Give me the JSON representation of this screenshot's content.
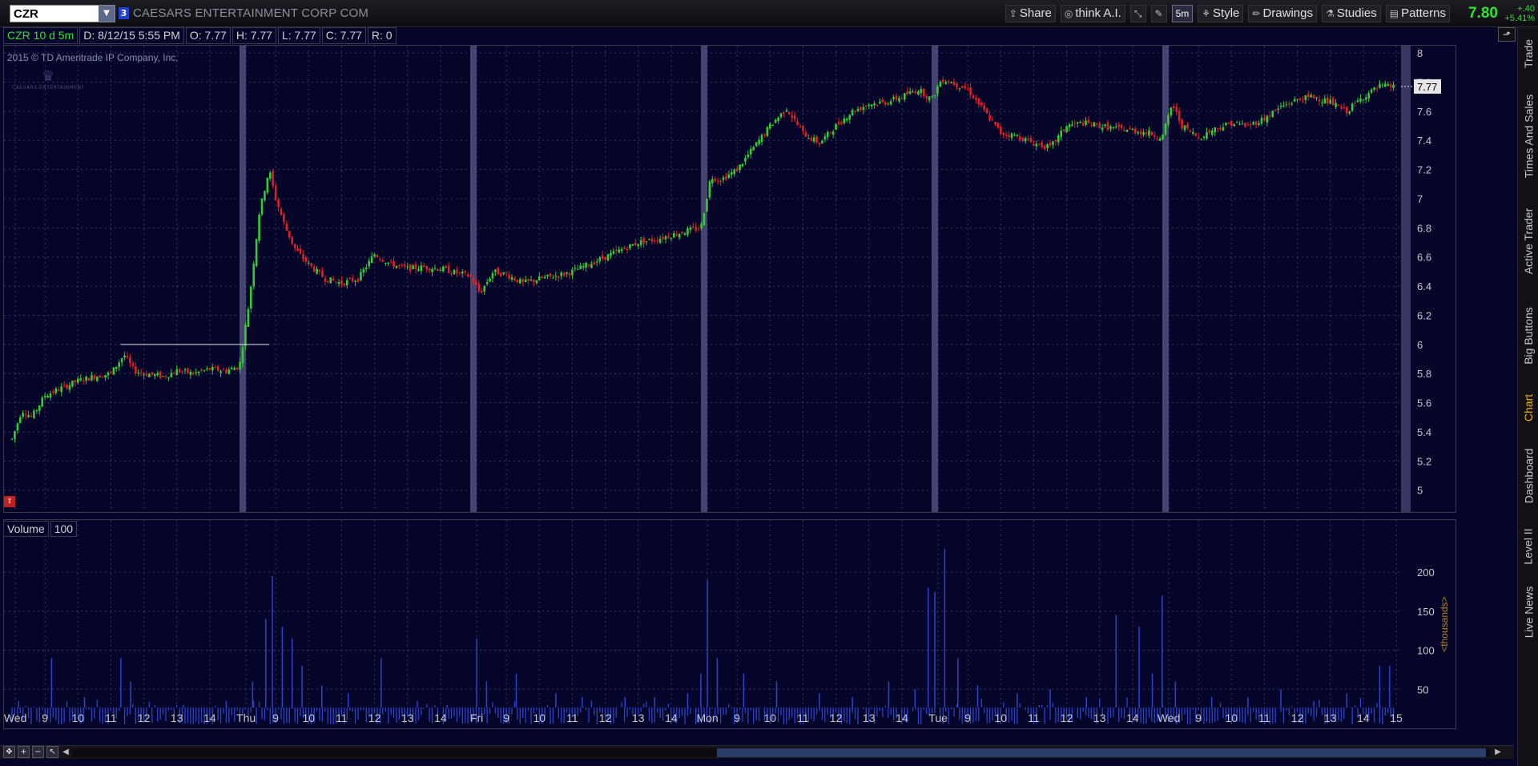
{
  "header": {
    "symbol": "CZR",
    "link_number": "3",
    "company_name": "CAESARS ENTERTAINMENT CORP COM",
    "tools": [
      {
        "label": "Share",
        "icon": "share-icon"
      },
      {
        "label": "think A.I.",
        "icon": "ai-icon"
      },
      {
        "label": "",
        "icon": "drawing-tools-icon"
      },
      {
        "label": "",
        "icon": "wrench-icon"
      },
      {
        "label": "5m",
        "icon": "aggregation-icon"
      },
      {
        "label": "Style",
        "icon": "style-icon"
      },
      {
        "label": "Drawings",
        "icon": "pencil-icon"
      },
      {
        "label": "Studies",
        "icon": "studies-icon"
      },
      {
        "label": "Patterns",
        "icon": "patterns-icon"
      }
    ],
    "last_price": "7.80",
    "change": "+.40",
    "change_pct": "+5.41%",
    "up_color": "#33e033"
  },
  "side_tabs": [
    {
      "label": "Trade",
      "active": false
    },
    {
      "label": "Times And Sales",
      "active": false
    },
    {
      "label": "Active Trader",
      "active": false
    },
    {
      "label": "Big Buttons",
      "active": false
    },
    {
      "label": "Chart",
      "active": true
    },
    {
      "label": "Dashboard",
      "active": false
    },
    {
      "label": "Level II",
      "active": false
    },
    {
      "label": "Live News",
      "active": false
    }
  ],
  "info_bar": {
    "symbol_period": "CZR 10 d 5m",
    "date": "D: 8/12/15 5:55 PM",
    "open": "O: 7.77",
    "high": "H: 7.77",
    "low": "L: 7.77",
    "close": "C: 7.77",
    "range": "R: 0"
  },
  "copyright": "2015 © TD Ameritrade IP Company, Inc.",
  "logo_text": "CAESARS ENTERTAINMENT",
  "volume_panel": {
    "label": "Volume",
    "value": "100",
    "unit_label": "<thousands>"
  },
  "colors": {
    "background": "#05052a",
    "up_candle": "#33cc33",
    "down_candle": "#e02020",
    "volume_bar": "#2a44cc",
    "grid": "#3a3a6a",
    "session_break": "#5a5a8a"
  },
  "chart_data": {
    "type": "candlestick",
    "symbol": "CZR",
    "period": "10 d",
    "aggregation": "5m",
    "price_axis": {
      "ticks": [
        5,
        5.2,
        5.4,
        5.6,
        5.8,
        6,
        6.2,
        6.4,
        6.6,
        6.8,
        7,
        7.2,
        7.4,
        7.6,
        7.8,
        8
      ],
      "tick_labels": [
        "5",
        "5.2",
        "5.4",
        "5.6",
        "5.8",
        "6",
        "6.2",
        "6.4",
        "6.6",
        "6.8",
        "7",
        "7.2",
        "7.4",
        "7.6",
        "7.8",
        "8"
      ],
      "range": [
        4.85,
        8.05
      ],
      "last_label": "7.77"
    },
    "volume_axis": {
      "ticks": [
        50,
        100,
        150,
        200
      ],
      "unit": "thousands",
      "range": [
        0,
        240
      ]
    },
    "time_axis": {
      "labels": [
        {
          "t": 0.1,
          "label": "Wed"
        },
        {
          "t": 1,
          "label": "9"
        },
        {
          "t": 2,
          "label": "10"
        },
        {
          "t": 3,
          "label": "11"
        },
        {
          "t": 4,
          "label": "12"
        },
        {
          "t": 5,
          "label": "13"
        },
        {
          "t": 6,
          "label": "14"
        },
        {
          "t": 7.1,
          "label": "Thu"
        },
        {
          "t": 8,
          "label": "9"
        },
        {
          "t": 9,
          "label": "10"
        },
        {
          "t": 10,
          "label": "11"
        },
        {
          "t": 11,
          "label": "12"
        },
        {
          "t": 12,
          "label": "13"
        },
        {
          "t": 13,
          "label": "14"
        },
        {
          "t": 14.1,
          "label": "Fri"
        },
        {
          "t": 15,
          "label": "9"
        },
        {
          "t": 16,
          "label": "10"
        },
        {
          "t": 17,
          "label": "11"
        },
        {
          "t": 18,
          "label": "12"
        },
        {
          "t": 19,
          "label": "13"
        },
        {
          "t": 20,
          "label": "14"
        },
        {
          "t": 21.1,
          "label": "Mon"
        },
        {
          "t": 22,
          "label": "9"
        },
        {
          "t": 23,
          "label": "10"
        },
        {
          "t": 24,
          "label": "11"
        },
        {
          "t": 25,
          "label": "12"
        },
        {
          "t": 26,
          "label": "13"
        },
        {
          "t": 27,
          "label": "14"
        },
        {
          "t": 28.1,
          "label": "Tue"
        },
        {
          "t": 29,
          "label": "9"
        },
        {
          "t": 30,
          "label": "10"
        },
        {
          "t": 31,
          "label": "11"
        },
        {
          "t": 32,
          "label": "12"
        },
        {
          "t": 33,
          "label": "13"
        },
        {
          "t": 34,
          "label": "14"
        },
        {
          "t": 35.1,
          "label": "Wed"
        },
        {
          "t": 36,
          "label": "9"
        },
        {
          "t": 37,
          "label": "10"
        },
        {
          "t": 38,
          "label": "11"
        },
        {
          "t": 39,
          "label": "12"
        },
        {
          "t": 40,
          "label": "13"
        },
        {
          "t": 41,
          "label": "14"
        },
        {
          "t": 42,
          "label": "15"
        }
      ],
      "session_breaks": [
        7,
        14,
        21,
        28,
        35
      ],
      "range": [
        0,
        42
      ]
    },
    "price_path": [
      [
        0,
        5.35
      ],
      [
        0.3,
        5.55
      ],
      [
        0.6,
        5.5
      ],
      [
        1,
        5.65
      ],
      [
        1.5,
        5.7
      ],
      [
        2,
        5.75
      ],
      [
        2.5,
        5.78
      ],
      [
        3,
        5.8
      ],
      [
        3.4,
        5.93
      ],
      [
        3.7,
        5.82
      ],
      [
        4,
        5.8
      ],
      [
        4.6,
        5.78
      ],
      [
        5,
        5.82
      ],
      [
        5.5,
        5.8
      ],
      [
        6,
        5.83
      ],
      [
        6.5,
        5.82
      ],
      [
        6.9,
        5.85
      ],
      [
        7.2,
        6.3
      ],
      [
        7.5,
        6.9
      ],
      [
        7.8,
        7.2
      ],
      [
        8,
        7.0
      ],
      [
        8.3,
        6.8
      ],
      [
        8.6,
        6.65
      ],
      [
        9,
        6.55
      ],
      [
        9.5,
        6.45
      ],
      [
        10,
        6.42
      ],
      [
        10.5,
        6.45
      ],
      [
        11,
        6.62
      ],
      [
        11.5,
        6.55
      ],
      [
        12,
        6.52
      ],
      [
        12.5,
        6.53
      ],
      [
        13,
        6.52
      ],
      [
        13.5,
        6.49
      ],
      [
        13.9,
        6.47
      ],
      [
        14.2,
        6.35
      ],
      [
        14.6,
        6.5
      ],
      [
        15,
        6.48
      ],
      [
        15.5,
        6.42
      ],
      [
        16,
        6.45
      ],
      [
        16.5,
        6.47
      ],
      [
        17,
        6.5
      ],
      [
        17.5,
        6.55
      ],
      [
        18,
        6.6
      ],
      [
        18.5,
        6.65
      ],
      [
        19,
        6.7
      ],
      [
        19.5,
        6.72
      ],
      [
        20,
        6.75
      ],
      [
        20.5,
        6.78
      ],
      [
        20.9,
        6.8
      ],
      [
        21.2,
        7.15
      ],
      [
        21.5,
        7.13
      ],
      [
        22,
        7.2
      ],
      [
        22.5,
        7.35
      ],
      [
        23,
        7.5
      ],
      [
        23.5,
        7.62
      ],
      [
        24,
        7.45
      ],
      [
        24.5,
        7.38
      ],
      [
        25,
        7.5
      ],
      [
        25.5,
        7.6
      ],
      [
        26,
        7.65
      ],
      [
        26.5,
        7.66
      ],
      [
        27,
        7.7
      ],
      [
        27.5,
        7.75
      ],
      [
        27.9,
        7.68
      ],
      [
        28.2,
        7.82
      ],
      [
        28.5,
        7.8
      ],
      [
        29,
        7.75
      ],
      [
        29.5,
        7.6
      ],
      [
        30,
        7.45
      ],
      [
        30.5,
        7.43
      ],
      [
        31,
        7.38
      ],
      [
        31.5,
        7.35
      ],
      [
        32,
        7.5
      ],
      [
        32.5,
        7.52
      ],
      [
        33,
        7.5
      ],
      [
        33.5,
        7.48
      ],
      [
        34,
        7.47
      ],
      [
        34.5,
        7.45
      ],
      [
        34.9,
        7.42
      ],
      [
        35.2,
        7.65
      ],
      [
        35.5,
        7.5
      ],
      [
        36,
        7.42
      ],
      [
        36.5,
        7.48
      ],
      [
        37,
        7.52
      ],
      [
        37.5,
        7.5
      ],
      [
        38,
        7.55
      ],
      [
        38.5,
        7.63
      ],
      [
        39,
        7.68
      ],
      [
        39.5,
        7.7
      ],
      [
        40,
        7.66
      ],
      [
        40.5,
        7.6
      ],
      [
        41,
        7.7
      ],
      [
        41.5,
        7.77
      ],
      [
        42,
        7.77
      ]
    ],
    "volume_spikes": [
      [
        0.2,
        35
      ],
      [
        1.2,
        90
      ],
      [
        2.2,
        40
      ],
      [
        3.3,
        90
      ],
      [
        3.6,
        60
      ],
      [
        5.2,
        30
      ],
      [
        6.5,
        35
      ],
      [
        7.3,
        60
      ],
      [
        7.7,
        140
      ],
      [
        7.9,
        195
      ],
      [
        8.2,
        130
      ],
      [
        8.5,
        115
      ],
      [
        8.8,
        80
      ],
      [
        9.4,
        55
      ],
      [
        10.2,
        45
      ],
      [
        11.2,
        90
      ],
      [
        12.3,
        35
      ],
      [
        13.2,
        30
      ],
      [
        14.1,
        115
      ],
      [
        14.4,
        60
      ],
      [
        15.3,
        70
      ],
      [
        16.5,
        45
      ],
      [
        17.3,
        40
      ],
      [
        18.6,
        40
      ],
      [
        19.5,
        40
      ],
      [
        20.5,
        45
      ],
      [
        20.9,
        70
      ],
      [
        21.1,
        190
      ],
      [
        21.4,
        90
      ],
      [
        22.2,
        70
      ],
      [
        23.2,
        60
      ],
      [
        24.5,
        45
      ],
      [
        25.5,
        40
      ],
      [
        26.6,
        60
      ],
      [
        27.4,
        50
      ],
      [
        27.8,
        180
      ],
      [
        28.0,
        175
      ],
      [
        28.3,
        230
      ],
      [
        28.7,
        90
      ],
      [
        29.3,
        55
      ],
      [
        30.5,
        45
      ],
      [
        31.5,
        50
      ],
      [
        32.6,
        40
      ],
      [
        33.5,
        145
      ],
      [
        34.2,
        130
      ],
      [
        34.6,
        70
      ],
      [
        34.9,
        170
      ],
      [
        35.3,
        60
      ],
      [
        36.4,
        40
      ],
      [
        37.5,
        40
      ],
      [
        38.5,
        50
      ],
      [
        39.5,
        35
      ],
      [
        40.5,
        45
      ],
      [
        41.5,
        80
      ],
      [
        41.8,
        80
      ]
    ],
    "horizontal_line": {
      "price": 6.0,
      "t_start": 3.3,
      "t_end": 7.8
    },
    "grid": true,
    "legend": "none"
  }
}
